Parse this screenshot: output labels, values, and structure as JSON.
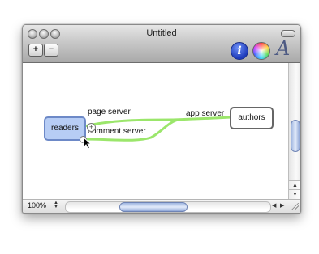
{
  "window": {
    "title": "Untitled"
  },
  "toolbar": {
    "add_label": "+",
    "remove_label": "−",
    "info_label": "i",
    "font_label": "A"
  },
  "graph": {
    "nodes": {
      "readers": "readers",
      "authors": "authors"
    },
    "edges": {
      "page_server": "page server",
      "comment_server": "comment server",
      "app_server": "app server"
    },
    "add_child_label": "+",
    "edge_color": "#9be66b"
  },
  "status": {
    "zoom": "100%"
  },
  "icons": {
    "close": "close-icon",
    "minimize": "minimize-icon",
    "zoom": "zoom-icon",
    "info": "info-icon",
    "colors": "color-wheel-icon",
    "fonts": "font-icon",
    "cursor": "arrow-cursor-icon",
    "grip": "resize-grip-icon"
  }
}
